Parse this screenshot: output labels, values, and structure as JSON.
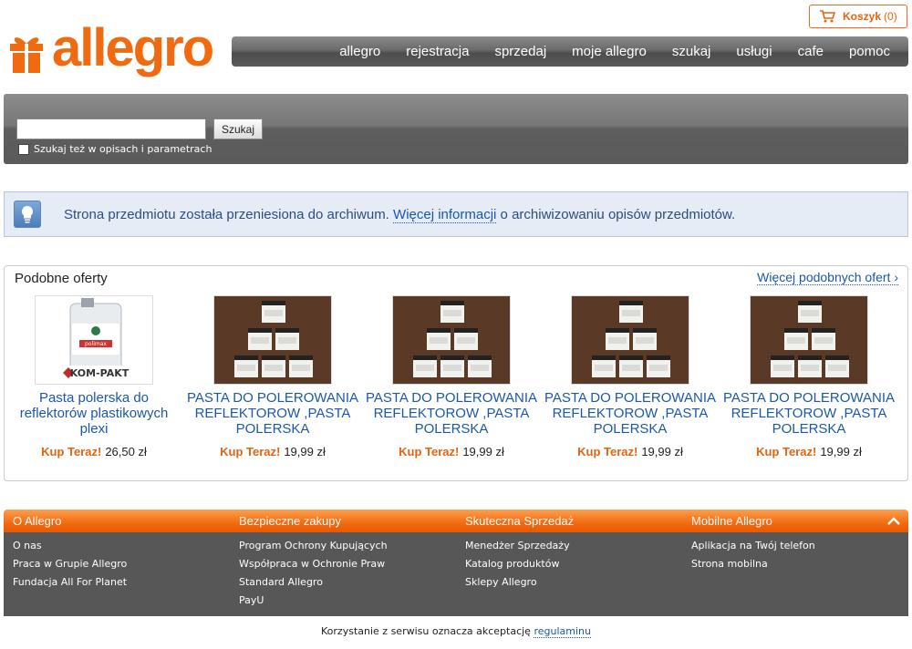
{
  "header": {
    "logo_text": "allegro",
    "cart": {
      "label": "Koszyk",
      "count": "(0)"
    },
    "nav": [
      "allegro",
      "rejestracja",
      "sprzedaj",
      "moje allegro",
      "szukaj",
      "usługi",
      "cafe",
      "pomoc"
    ]
  },
  "search": {
    "input_value": "",
    "button_label": "Szukaj",
    "checkbox_label": "Szukaj też w opisach i parametrach"
  },
  "info": {
    "text_before": "Strona przedmiotu została przeniesiona do archiwum. ",
    "link_text": "Więcej informacji",
    "text_after": " o archiwizowaniu opisów przedmiotów."
  },
  "similar": {
    "title": "Podobne oferty",
    "more_link": "Więcej podobnych ofert ›",
    "offers": [
      {
        "name": "Pasta polerska do reflektorów plastikowych plexi",
        "buy_label": "Kup Teraz!",
        "price": "26,50 zł",
        "image": "bottle"
      },
      {
        "name": "PASTA DO POLEROWANIA REFLEKTOROW ,PASTA POLERSKA",
        "buy_label": "Kup Teraz!",
        "price": "19,99 zł",
        "image": "jars"
      },
      {
        "name": "PASTA DO POLEROWANIA REFLEKTOROW ,PASTA POLERSKA",
        "buy_label": "Kup Teraz!",
        "price": "19,99 zł",
        "image": "jars"
      },
      {
        "name": "PASTA DO POLEROWANIA REFLEKTOROW ,PASTA POLERSKA",
        "buy_label": "Kup Teraz!",
        "price": "19,99 zł",
        "image": "jars"
      },
      {
        "name": "PASTA DO POLEROWANIA REFLEKTOROW ,PASTA POLERSKA",
        "buy_label": "Kup Teraz!",
        "price": "19,99 zł",
        "image": "jars"
      }
    ],
    "bottle_brand": "polimax",
    "bottle_logo": "KOM-PAKT"
  },
  "footer": {
    "columns": [
      {
        "title": "O Allegro",
        "links": [
          "O nas",
          "Praca w Grupie Allegro",
          "Fundacja All For Planet"
        ]
      },
      {
        "title": "Bezpieczne zakupy",
        "links": [
          "Program Ochrony Kupujących",
          "Współpraca w Ochronie Praw",
          "Standard Allegro",
          "PayU"
        ]
      },
      {
        "title": "Skuteczna Sprzedaż",
        "links": [
          "Menedżer Sprzedaży",
          "Katalog produktów",
          "Sklepy Allegro"
        ]
      },
      {
        "title": "Mobilne Allegro",
        "links": [
          "Aplikacja na Twój telefon",
          "Strona mobilna"
        ]
      }
    ],
    "terms_before": "Korzystanie z serwisu oznacza akceptację ",
    "terms_link": "regulaminu"
  },
  "colors": {
    "brand": "#f26a10",
    "link": "#1b58a8",
    "footer": "#575757"
  }
}
